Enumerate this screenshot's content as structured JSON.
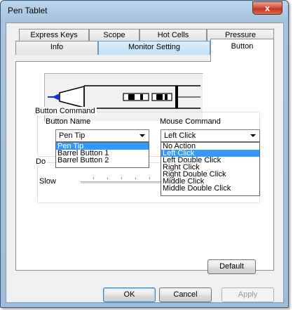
{
  "window": {
    "title": "Pen Tablet",
    "close_glyph": "x"
  },
  "tabs": {
    "row1": [
      "Express Keys",
      "Scope",
      "Hot Cells",
      "Pressure"
    ],
    "row2": [
      "Info",
      "Monitor Setting",
      "Button"
    ],
    "active": "Button"
  },
  "button_command": {
    "group_label": "Button Command",
    "button_name_label": "Button Name",
    "mouse_command_label": "Mouse Command",
    "button_name_value": "Pen Tip",
    "mouse_command_value": "Left Click",
    "button_name_options": [
      "Pen Tip",
      "Barrel Button 1",
      "Barrel Button 2"
    ],
    "button_name_selected": "Pen Tip",
    "mouse_command_options": [
      "No Action",
      "Left Click",
      "Left Double Click",
      "Right Click",
      "Right Double Click",
      "Middle Click",
      "Middle Double Click"
    ],
    "mouse_command_selected": "Left Click"
  },
  "double_click": {
    "group_label_visible": "Do",
    "slow_label": "Slow"
  },
  "buttons": {
    "default": "Default",
    "ok": "OK",
    "cancel": "Cancel",
    "apply": "Apply"
  },
  "colors": {
    "highlight": "#3399ff",
    "tab_highlight": "#c1e0f8",
    "pen_tip": "#1a2fd6"
  }
}
